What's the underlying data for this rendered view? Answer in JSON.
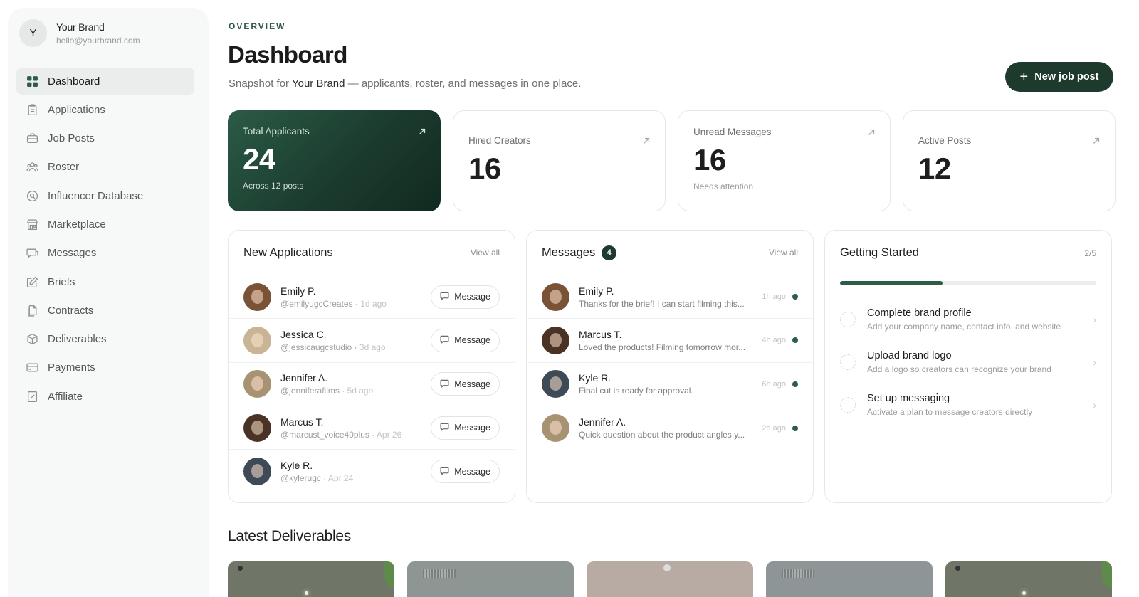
{
  "brand": {
    "initial": "Y",
    "name": "Your Brand",
    "email": "hello@yourbrand.com"
  },
  "nav": [
    {
      "label": "Dashboard",
      "icon": "grid-icon",
      "active": true
    },
    {
      "label": "Applications",
      "icon": "clipboard-icon"
    },
    {
      "label": "Job Posts",
      "icon": "briefcase-icon"
    },
    {
      "label": "Roster",
      "icon": "users-icon"
    },
    {
      "label": "Influencer Database",
      "icon": "search-circle-icon"
    },
    {
      "label": "Marketplace",
      "icon": "store-icon"
    },
    {
      "label": "Messages",
      "icon": "chat-icon"
    },
    {
      "label": "Briefs",
      "icon": "pencil-icon"
    },
    {
      "label": "Contracts",
      "icon": "document-icon"
    },
    {
      "label": "Deliverables",
      "icon": "box-icon"
    },
    {
      "label": "Payments",
      "icon": "credit-card-icon"
    },
    {
      "label": "Affiliate",
      "icon": "receipt-icon"
    }
  ],
  "header": {
    "eyebrow": "OVERVIEW",
    "title": "Dashboard",
    "subtitle_prefix": "Snapshot for",
    "subtitle_brand": "Your Brand",
    "subtitle_suffix": "— applicants, roster, and messages in one place.",
    "new_job_label": "New job post"
  },
  "stats": [
    {
      "label": "Total Applicants",
      "value": "24",
      "note": "Across 12 posts",
      "featured": true
    },
    {
      "label": "Hired Creators",
      "value": "16",
      "note": ""
    },
    {
      "label": "Unread Messages",
      "value": "16",
      "note": "Needs attention"
    },
    {
      "label": "Active Posts",
      "value": "12",
      "note": ""
    }
  ],
  "applications": {
    "title": "New Applications",
    "view_all": "View all",
    "button_label": "Message",
    "items": [
      {
        "name": "Emily P.",
        "handle": "@emilyugcCreates",
        "time": "1d ago",
        "color": "#7a5236"
      },
      {
        "name": "Jessica C.",
        "handle": "@jessicaugcstudio",
        "time": "3d ago",
        "color": "#c9b596"
      },
      {
        "name": "Jennifer A.",
        "handle": "@jenniferafilms",
        "time": "5d ago",
        "color": "#a89274"
      },
      {
        "name": "Marcus T.",
        "handle": "@marcust_voice40plus",
        "time": "Apr 26",
        "color": "#4a3324"
      },
      {
        "name": "Kyle R.",
        "handle": "@kylerugc",
        "time": "Apr 24",
        "color": "#3e4a55"
      }
    ]
  },
  "messages": {
    "title": "Messages",
    "badge": "4",
    "view_all": "View all",
    "items": [
      {
        "name": "Emily P.",
        "preview": "Thanks for the brief! I can start filming this...",
        "time": "1h ago",
        "color": "#7a5236"
      },
      {
        "name": "Marcus T.",
        "preview": "Loved the products! Filming tomorrow mor...",
        "time": "4h ago",
        "color": "#4a3324"
      },
      {
        "name": "Kyle R.",
        "preview": "Final cut is ready for approval.",
        "time": "6h ago",
        "color": "#3e4a55"
      },
      {
        "name": "Jennifer A.",
        "preview": "Quick question about the product angles y...",
        "time": "2d ago",
        "color": "#a89274"
      }
    ]
  },
  "getting_started": {
    "title": "Getting Started",
    "progress_label": "2/5",
    "progress": 0.4,
    "tasks": [
      {
        "title": "Complete brand profile",
        "desc": "Add your company name, contact info, and website"
      },
      {
        "title": "Upload brand logo",
        "desc": "Add a logo so creators can recognize your brand"
      },
      {
        "title": "Set up messaging",
        "desc": "Activate a plan to message creators directly"
      }
    ]
  },
  "deliverables": {
    "title": "Latest Deliverables",
    "thumb_colors": [
      "#6f7668",
      "#8e9694",
      "#b8aba3",
      "#8d9596",
      "#6f7668"
    ]
  },
  "colors": {
    "accent": "#1d3a2d",
    "accent_light": "#2d5e45"
  }
}
